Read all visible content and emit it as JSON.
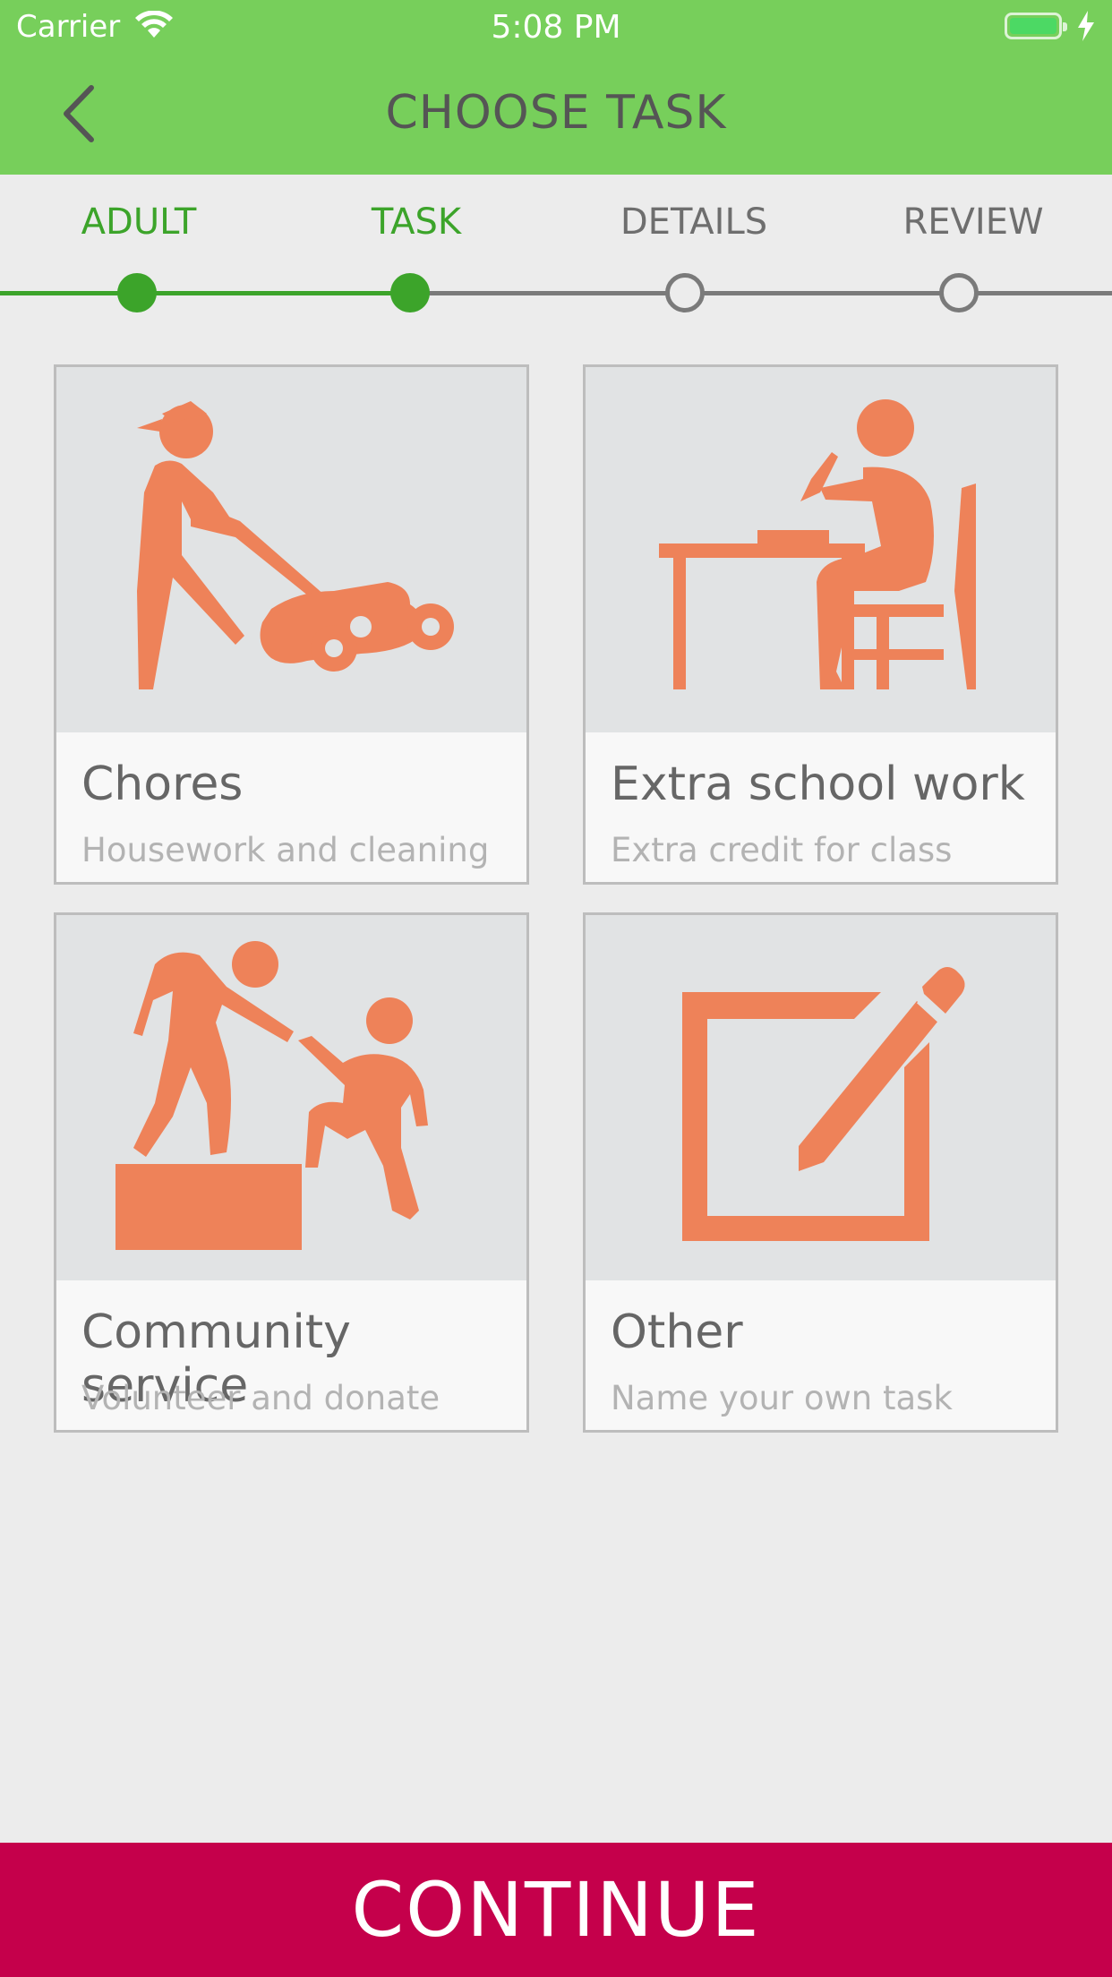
{
  "status_bar": {
    "carrier": "Carrier",
    "time": "5:08 PM"
  },
  "nav": {
    "title": "CHOOSE TASK",
    "back_icon": "chevron-left-icon"
  },
  "stepper": {
    "steps": [
      {
        "label": "ADULT",
        "state": "done"
      },
      {
        "label": "TASK",
        "state": "done"
      },
      {
        "label": "DETAILS",
        "state": "todo"
      },
      {
        "label": "REVIEW",
        "state": "todo"
      }
    ],
    "active_color": "#3ca42a",
    "inactive_color": "#7a7a7a"
  },
  "tasks": [
    {
      "title": "Chores",
      "subtitle": "Housework and cleaning",
      "icon": "lawn-mower-icon"
    },
    {
      "title": "Extra school work",
      "subtitle": "Extra credit for class",
      "icon": "student-desk-icon"
    },
    {
      "title": "Community service",
      "subtitle": "Volunteer and donate",
      "icon": "helping-hand-icon"
    },
    {
      "title": "Other",
      "subtitle": "Name your own task",
      "icon": "edit-square-icon"
    }
  ],
  "icon_color": "#ee8259",
  "continue_button": {
    "label": "CONTINUE",
    "color": "#c5004b"
  },
  "header_color": "#77cf5b"
}
